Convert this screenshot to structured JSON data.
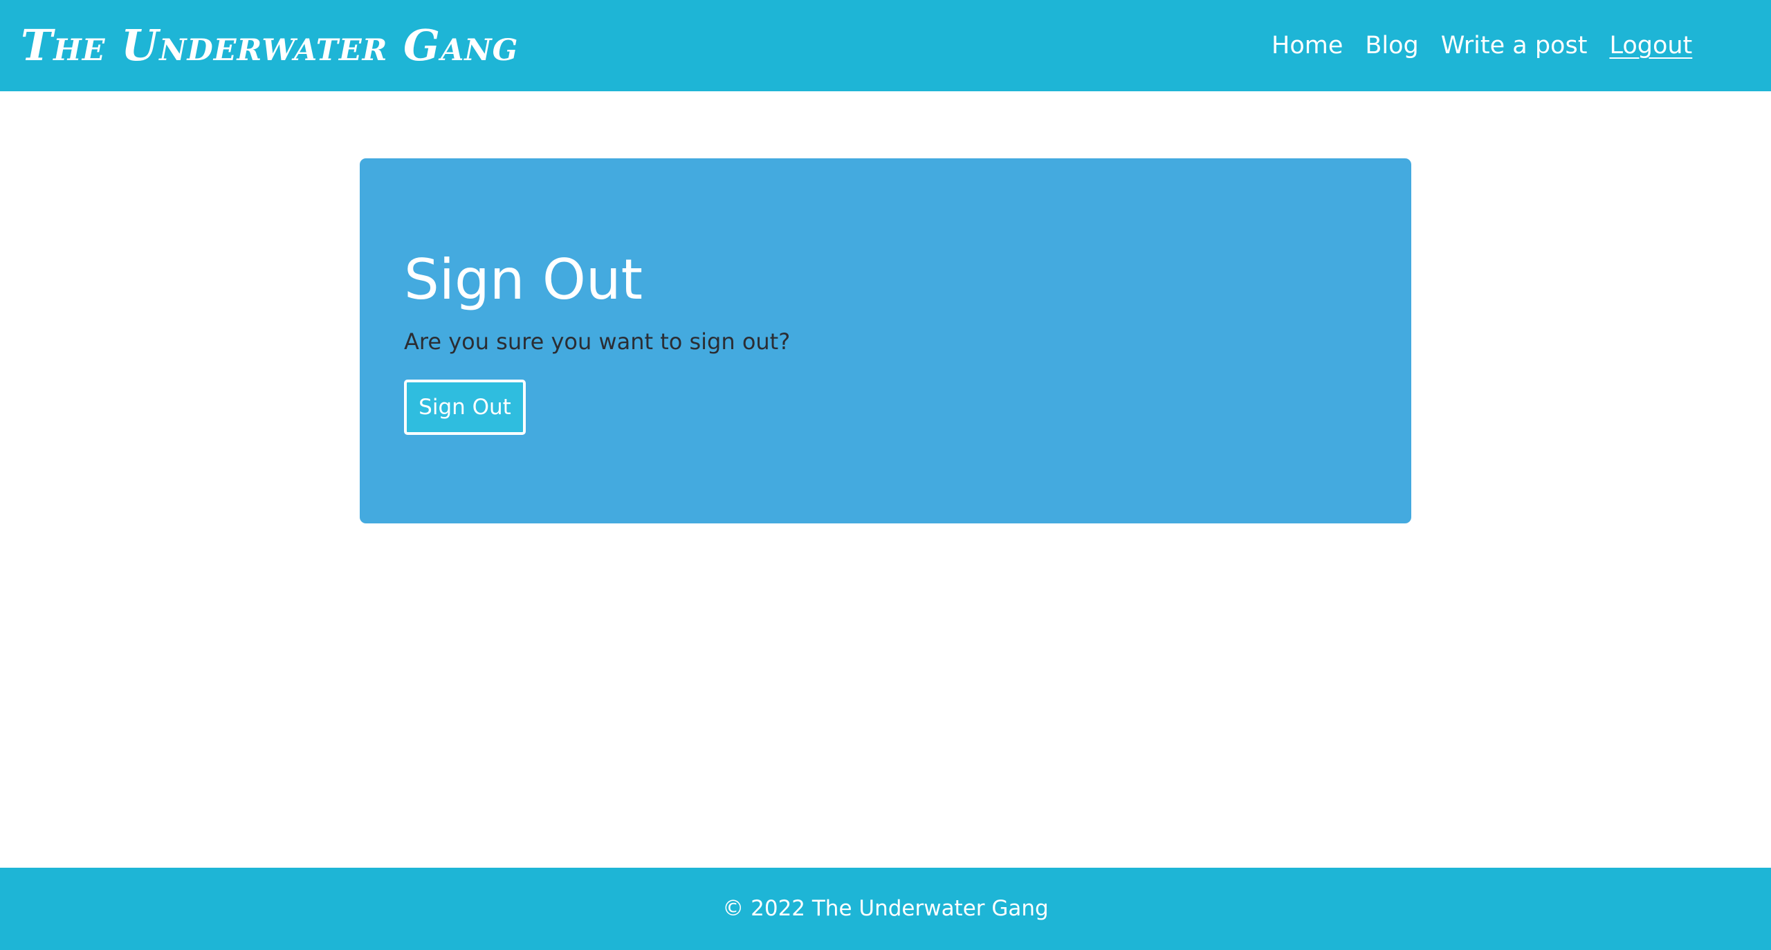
{
  "header": {
    "brand": "The Underwater Gang",
    "nav": [
      {
        "label": "Home"
      },
      {
        "label": "Blog"
      },
      {
        "label": "Write a post"
      },
      {
        "label": "Logout"
      }
    ]
  },
  "main": {
    "title": "Sign Out",
    "description": "Are you sure you want to sign out?",
    "button_label": "Sign Out"
  },
  "footer": {
    "text": "© 2022 The Underwater Gang"
  },
  "colors": {
    "navbar": "#1eb5d6",
    "card": "#44aadf",
    "button": "#2fbddf",
    "description_text": "#2b2d33"
  }
}
